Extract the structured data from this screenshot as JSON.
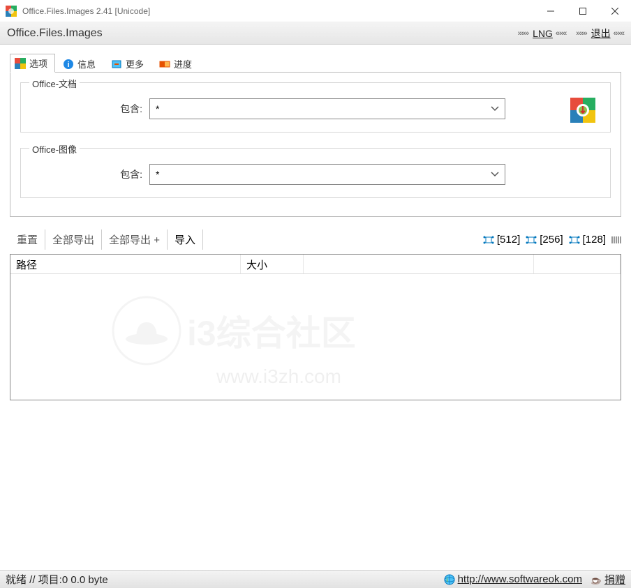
{
  "window": {
    "title": "Office.Files.Images 2.41 [Unicode]"
  },
  "toolbar": {
    "title": "Office.Files.Images",
    "lng": "LNG",
    "exit": "退出"
  },
  "tabs": {
    "options": "选项",
    "info": "信息",
    "more": "更多",
    "progress": "进度"
  },
  "doc": {
    "legend": "Office-文档",
    "label": "包含:",
    "value": "*"
  },
  "img": {
    "legend": "Office-图像",
    "label": "包含:",
    "value": "*"
  },
  "mid": {
    "reset": "重置",
    "exportall": "全部导出",
    "exportallplus": "全部导出 +",
    "import": "导入",
    "s512": "[512]",
    "s256": "[256]",
    "s128": "[128]"
  },
  "cols": {
    "path": "路径",
    "size": "大小"
  },
  "status": {
    "text": "就绪 // 项目:0 0.0 byte",
    "url": "http://www.softwareok.com",
    "donate": "捐赠"
  },
  "watermark": {
    "text": "i3综合社区",
    "url": "www.i3zh.com"
  }
}
